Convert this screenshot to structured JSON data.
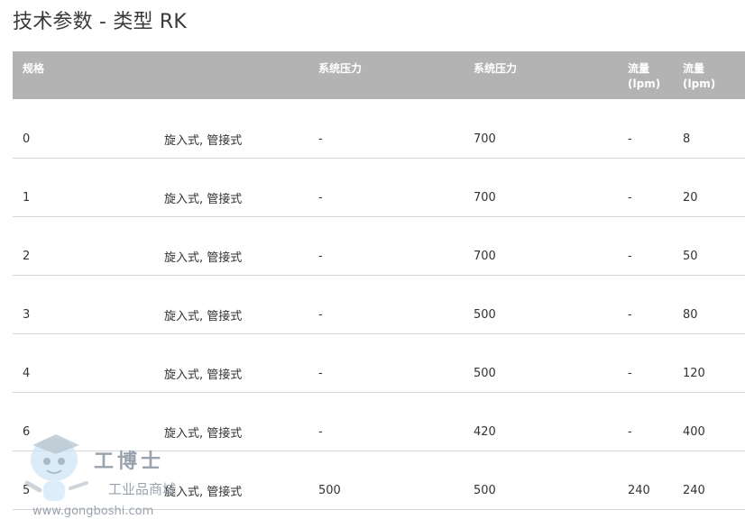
{
  "page": {
    "title": "技术参数 - 类型 RK"
  },
  "table": {
    "headers": [
      "规格",
      "",
      "系统压力",
      "系统压力",
      "流量\n(lpm)",
      "流量\n(lpm)"
    ],
    "rows": [
      [
        "0",
        "旋入式, 管接式",
        "-",
        "700",
        "-",
        "8"
      ],
      [
        "1",
        "旋入式, 管接式",
        "-",
        "700",
        "-",
        "20"
      ],
      [
        "2",
        "旋入式, 管接式",
        "-",
        "700",
        "-",
        "50"
      ],
      [
        "3",
        "旋入式, 管接式",
        "-",
        "500",
        "-",
        "80"
      ],
      [
        "4",
        "旋入式, 管接式",
        "-",
        "500",
        "-",
        "120"
      ],
      [
        "6",
        "旋入式, 管接式",
        "-",
        "420",
        "-",
        "400"
      ],
      [
        "5",
        "旋入式, 管接式",
        "500",
        "500",
        "240",
        "240"
      ]
    ]
  },
  "watermark": {
    "brand": "工博士",
    "subtitle": "工业品商城",
    "url": "www.gongboshi.com"
  }
}
